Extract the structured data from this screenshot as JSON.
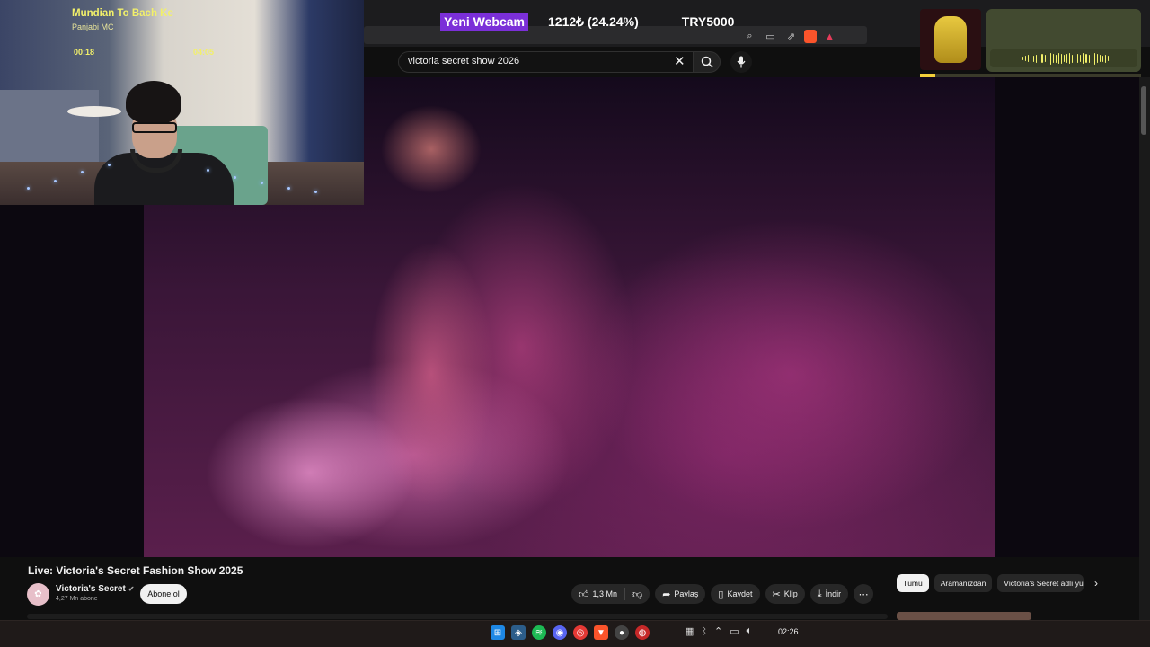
{
  "overlay": {
    "webcam_label": "Yeni Webcam",
    "stat_value": "1212₺ (24.24%)",
    "target": "TRY5000"
  },
  "search": {
    "query": "victoria secret show 2026"
  },
  "music": {
    "title": "Mundian To Bach Ke",
    "artist": "Panjabi MC",
    "elapsed": "00:18",
    "duration": "04:05",
    "progress_fraction": 0.07
  },
  "video": {
    "title": "Live: Victoria's Secret Fashion Show 2025"
  },
  "channel": {
    "name": "Victoria's Secret",
    "subscribers": "4,27 Mn abone",
    "subscribe_label": "Abone ol"
  },
  "actions": {
    "likes": "1,3 Mn",
    "share": "Paylaş",
    "save": "Kaydet",
    "clip": "Klip",
    "download": "İndir"
  },
  "chips": {
    "all": "Tümü",
    "from_search": "Aramanızdan",
    "channel_chip": "Victoria's Secret adlı yük"
  },
  "taskbar": {
    "time": "02:26"
  },
  "colors": {
    "webcam_badge": "#7b2fd8",
    "music_accent": "#f2f06a",
    "youtube_bg": "#0f0f0f"
  }
}
